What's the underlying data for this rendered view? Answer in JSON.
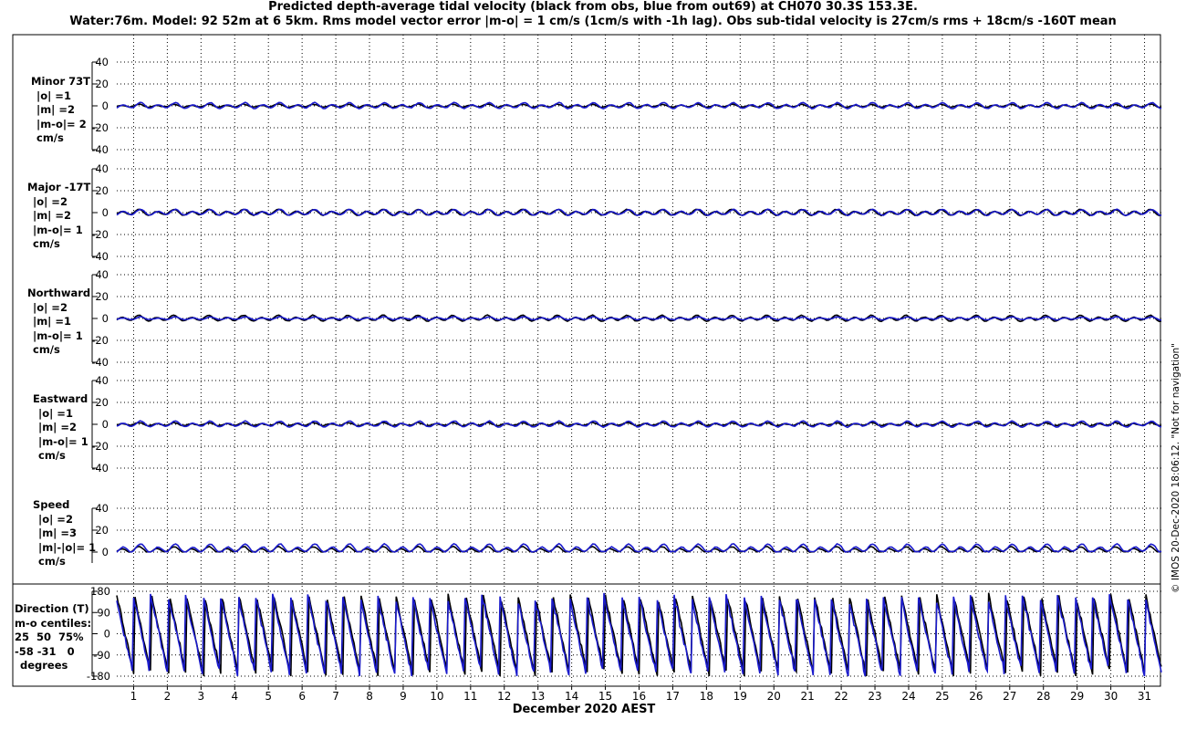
{
  "header": {
    "title_line1": "Predicted depth-average tidal velocity (black from obs, blue from out69) at CH070 30.3S 153.3E.",
    "title_line2": "Water:76m. Model: 92 52m at 6 5km. Rms model vector error |m-o| = 1 cm/s (1cm/s with -1h lag). Obs sub-tidal velocity is 27cm/s rms + 18cm/s -160T mean"
  },
  "footer": {
    "xlabel": "December 2020 AEST",
    "credit": "© IMOS 20-Dec-2020 18:06:12. \"Not for navigation\""
  },
  "colors": {
    "obs": "#000000",
    "model": "#1a1acc",
    "grid": "#000000"
  },
  "chart_data": [
    {
      "type": "line",
      "panel": "minor",
      "label_lines": [
        "Minor 73T",
        "|o| =1",
        "|m| =2",
        "|m-o|= 2",
        "cm/s"
      ],
      "ylim": [
        -40,
        40
      ],
      "yticks": [
        -40,
        -20,
        0,
        20,
        40
      ],
      "x": {
        "start": 0.5,
        "end": 31.5,
        "unit": "day of December 2020"
      },
      "series": [
        {
          "role": "obs",
          "amplitude": 1,
          "phase_hours": 0
        },
        {
          "role": "model",
          "amplitude": 2,
          "phase_hours": -1
        }
      ]
    },
    {
      "type": "line",
      "panel": "major",
      "label_lines": [
        "Major -17T",
        "|o| =2",
        "|m| =2",
        "|m-o|= 1",
        "cm/s"
      ],
      "ylim": [
        -40,
        40
      ],
      "yticks": [
        -40,
        -20,
        0,
        20,
        40
      ],
      "x": {
        "start": 0.5,
        "end": 31.5,
        "unit": "day of December 2020"
      },
      "series": [
        {
          "role": "obs",
          "amplitude": 2,
          "phase_hours": 0
        },
        {
          "role": "model",
          "amplitude": 2,
          "phase_hours": -1
        }
      ]
    },
    {
      "type": "line",
      "panel": "northward",
      "label_lines": [
        "Northward",
        "|o| =2",
        "|m| =1",
        "|m-o|= 1",
        "cm/s"
      ],
      "ylim": [
        -40,
        40
      ],
      "yticks": [
        -40,
        -20,
        0,
        20,
        40
      ],
      "x": {
        "start": 0.5,
        "end": 31.5,
        "unit": "day of December 2020"
      },
      "series": [
        {
          "role": "obs",
          "amplitude": 2,
          "phase_hours": 0
        },
        {
          "role": "model",
          "amplitude": 1,
          "phase_hours": -1
        }
      ]
    },
    {
      "type": "line",
      "panel": "eastward",
      "label_lines": [
        "Eastward",
        "|o| =1",
        "|m| =2",
        "|m-o|= 1",
        "cm/s"
      ],
      "ylim": [
        -40,
        40
      ],
      "yticks": [
        -40,
        -20,
        0,
        20,
        40
      ],
      "x": {
        "start": 0.5,
        "end": 31.5,
        "unit": "day of December 2020"
      },
      "series": [
        {
          "role": "obs",
          "amplitude": 1,
          "phase_hours": 0
        },
        {
          "role": "model",
          "amplitude": 2,
          "phase_hours": -1
        }
      ]
    },
    {
      "type": "line",
      "panel": "speed",
      "label_lines": [
        "Speed",
        "|o| =2",
        "|m| =3",
        "|m|-|o|= 1",
        "cm/s"
      ],
      "ylim": [
        -10,
        40
      ],
      "yticks": [
        0,
        20,
        40
      ],
      "x": {
        "start": 0.5,
        "end": 31.5,
        "unit": "day of December 2020"
      },
      "series": [
        {
          "role": "obs",
          "amplitude": 2,
          "phase_hours": 0
        },
        {
          "role": "model",
          "amplitude": 3,
          "phase_hours": -1
        }
      ]
    },
    {
      "type": "line",
      "panel": "direction",
      "label_lines": [
        "Direction (T)",
        "m-o centiles:",
        "25  50  75%",
        "-58 -31   0",
        "degrees"
      ],
      "ylim": [
        -180,
        180
      ],
      "yticks": [
        -180,
        -90,
        0,
        90,
        180
      ],
      "x": {
        "start": 0.5,
        "end": 31.5,
        "unit": "day of December 2020"
      },
      "series": [
        {
          "role": "obs",
          "wrapping_degrees": true
        },
        {
          "role": "model",
          "wrapping_degrees": true
        }
      ]
    }
  ],
  "x_axis": {
    "tick_labels": [
      "1",
      "2",
      "3",
      "4",
      "5",
      "6",
      "7",
      "8",
      "9",
      "10",
      "11",
      "12",
      "13",
      "14",
      "15",
      "16",
      "17",
      "18",
      "19",
      "20",
      "21",
      "22",
      "23",
      "24",
      "25",
      "26",
      "27",
      "28",
      "29",
      "30",
      "31"
    ]
  }
}
